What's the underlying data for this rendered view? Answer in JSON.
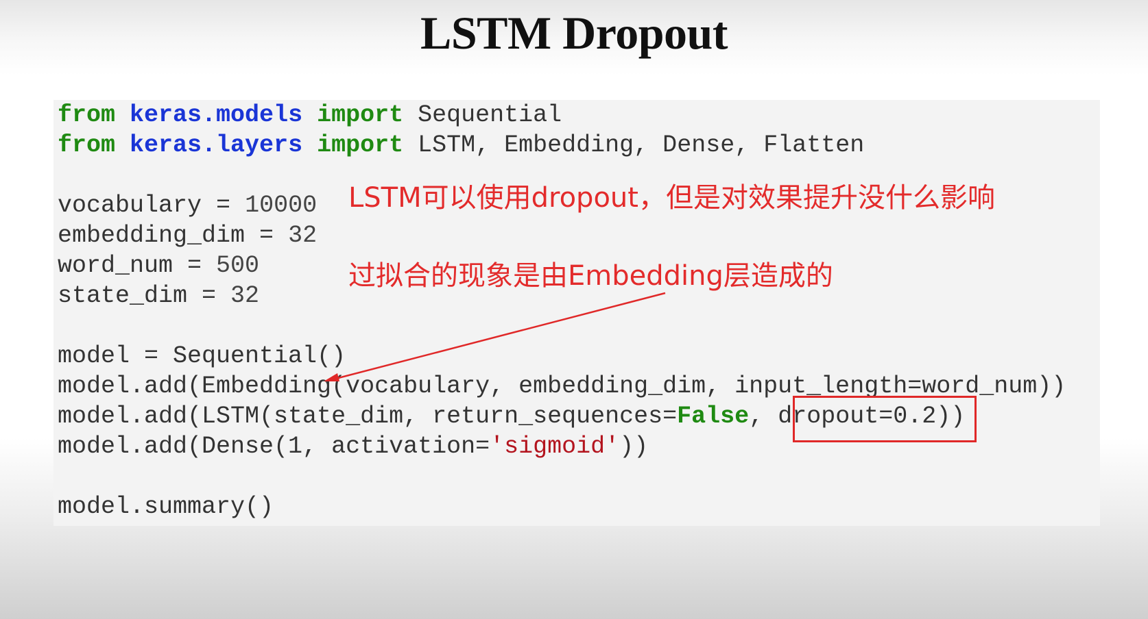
{
  "slide": {
    "title": "LSTM Dropout"
  },
  "code": {
    "line1": {
      "kw1": "from",
      "mod": "keras.models",
      "kw2": "import",
      "rest": " Sequential"
    },
    "line2": {
      "kw1": "from",
      "mod": "keras.layers",
      "kw2": "import",
      "rest": " LSTM, Embedding, Dense, Flatten"
    },
    "line3": {
      "name": "vocabulary",
      "op": " = ",
      "value": "10000"
    },
    "line4": {
      "name": "embedding_dim",
      "op": " = ",
      "value": "32"
    },
    "line5": {
      "name": "word_num",
      "op": " = ",
      "value": "500"
    },
    "line6": {
      "name": "state_dim",
      "op": " = ",
      "value": "32"
    },
    "line7": {
      "text": "model = Sequential()"
    },
    "line8": {
      "text": "model.add(Embedding(vocabulary, embedding_dim, input_length=word_num))"
    },
    "line9": {
      "pre": "model.add(LSTM(state_dim, return_sequences=",
      "bool": "False",
      "mid": ", dropout=0.2))"
    },
    "line10": {
      "pre": "model.add(Dense(1, activation=",
      "str": "'sigmoid'",
      "post": "))"
    },
    "line11": {
      "text": "model.summary()"
    }
  },
  "annotations": {
    "note1": "LSTM可以使用dropout，但是对效果提升没什么影响",
    "note2": "过拟合的现象是由Embedding层造成的"
  },
  "colors": {
    "keyword": "#1f8a12",
    "module": "#1a35d6",
    "string": "#b3141e",
    "annotation": "#e32b2b"
  }
}
